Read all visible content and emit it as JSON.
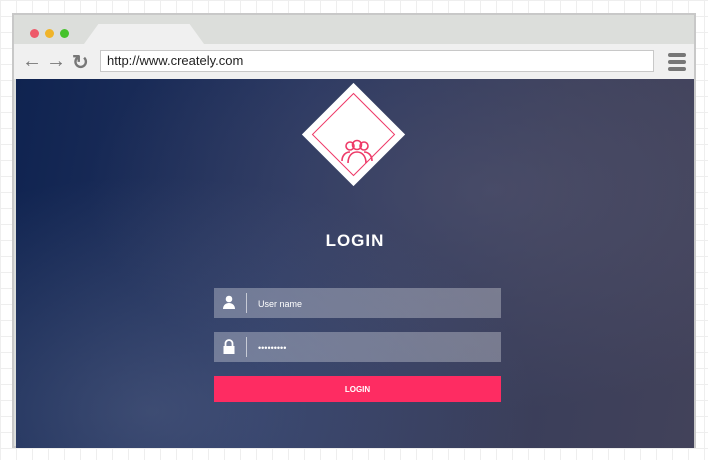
{
  "browser": {
    "url": "http://www.creately.com",
    "traffic_colors": [
      "#ee5a6a",
      "#f0b429",
      "#46c22c"
    ]
  },
  "login": {
    "title": "LOGIN",
    "username_placeholder": "User name",
    "password_value": "•••••••••",
    "button_label": "LOGIN",
    "accent": "#fe2c62"
  }
}
